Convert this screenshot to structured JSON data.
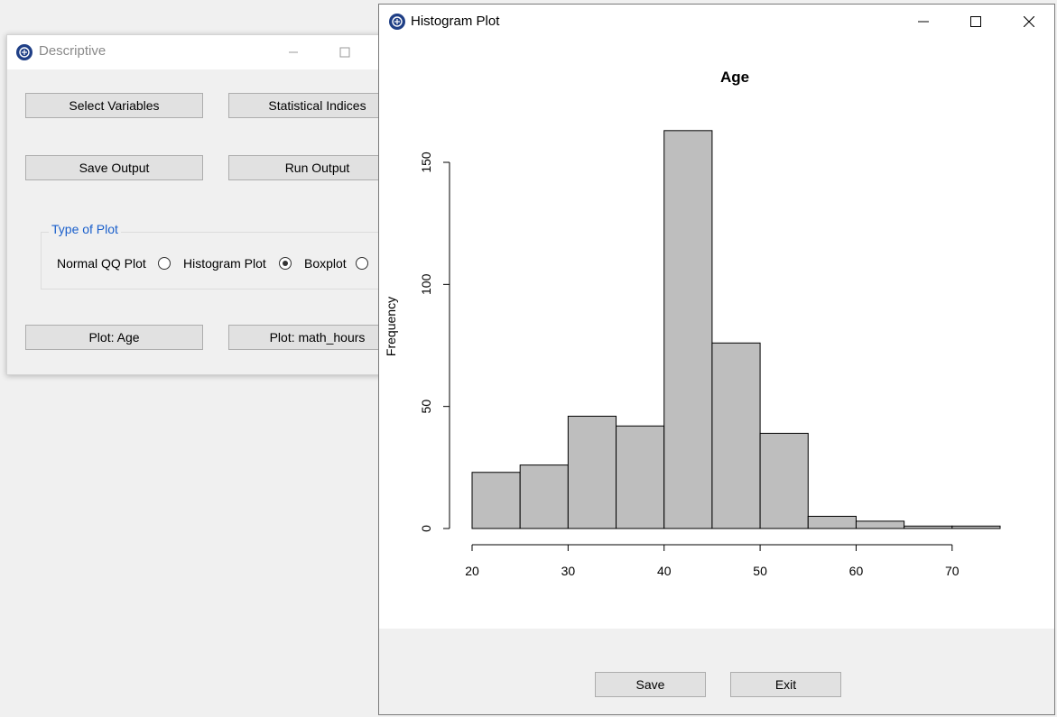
{
  "descriptive_window": {
    "title": "Descriptive",
    "buttons": {
      "select_variables": "Select Variables",
      "statistical_indices": "Statistical Indices",
      "save_output": "Save Output",
      "run_output": "Run Output",
      "plot_age": "Plot: Age",
      "plot_math_hours": "Plot: math_hours"
    },
    "plot_type_group": {
      "title": "Type of Plot",
      "options": [
        "Normal QQ Plot",
        "Histogram Plot",
        "Boxplot"
      ],
      "selected": "Histogram Plot"
    }
  },
  "histogram_window": {
    "title": "Histogram Plot",
    "buttons": {
      "save": "Save",
      "exit": "Exit"
    }
  },
  "colors": {
    "bar_fill": "#bebebe",
    "group_title": "#1a5fcb",
    "app_icon": "#1f3f86"
  },
  "chart_data": {
    "type": "bar",
    "title": "Age",
    "xlabel": "",
    "ylabel": "Frequency",
    "bin_edges": [
      20,
      25,
      30,
      35,
      40,
      45,
      50,
      55,
      60,
      65,
      70,
      75
    ],
    "values": [
      23,
      26,
      46,
      42,
      163,
      76,
      39,
      5,
      3,
      1,
      1
    ],
    "xlim": [
      20,
      75
    ],
    "ylim": [
      0,
      150
    ],
    "x_ticks": [
      20,
      30,
      40,
      50,
      60,
      70
    ],
    "y_ticks": [
      0,
      50,
      100,
      150
    ],
    "grid": false
  }
}
